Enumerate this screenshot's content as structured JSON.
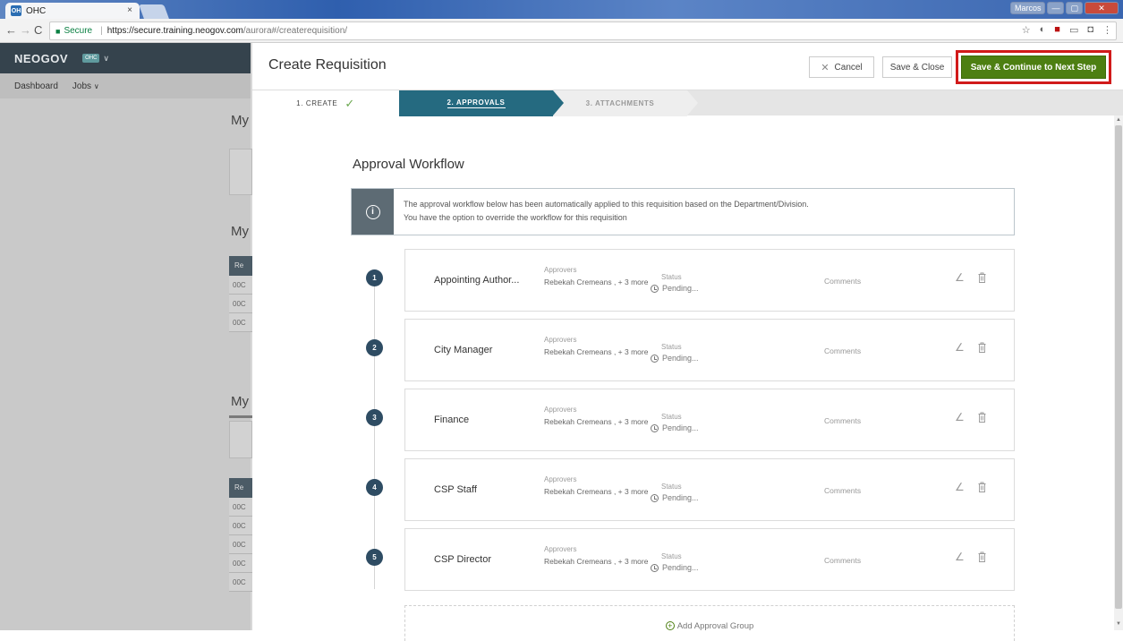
{
  "browser": {
    "tab_title": "OHC",
    "tab_favicon": "OH",
    "tab_close": "×",
    "window_user": "Marcos",
    "secure_label": "Secure",
    "url_host": "https://secure.training.neogov.com",
    "url_path": "/aurora#/createrequisition/"
  },
  "app": {
    "logo": "NEOGOV",
    "org_badge": "OHC",
    "nav": [
      "Dashboard",
      "Jobs"
    ],
    "bg_headings": [
      "My",
      "My",
      "My"
    ],
    "bg_header_label": "Re",
    "bg_row_label": "00C"
  },
  "modal": {
    "title": "Create Requisition",
    "cancel_label": "Cancel",
    "save_close_label": "Save & Close",
    "save_continue_label": "Save & Continue to Next Step",
    "steps": [
      {
        "label": "1. CREATE",
        "state": "complete"
      },
      {
        "label": "2. APPROVALS",
        "state": "active"
      },
      {
        "label": "3. ATTACHMENTS",
        "state": "upcoming"
      }
    ],
    "section_title": "Approval Workflow",
    "info_line1": "The approval workflow below has been automatically applied to this requisition based on the Department/Division.",
    "info_line2": "You have the option to override the workflow for this requisition",
    "labels": {
      "approvers": "Approvers",
      "status": "Status",
      "comments": "Comments"
    },
    "groups": [
      {
        "number": "1",
        "name": "Appointing Author...",
        "approvers": "Rebekah Cremeans , + 3 more",
        "status": "Pending..."
      },
      {
        "number": "2",
        "name": "City Manager",
        "approvers": "Rebekah Cremeans , + 3 more",
        "status": "Pending..."
      },
      {
        "number": "3",
        "name": "Finance",
        "approvers": "Rebekah Cremeans , + 3 more",
        "status": "Pending..."
      },
      {
        "number": "4",
        "name": "CSP Staff",
        "approvers": "Rebekah Cremeans , + 3 more",
        "status": "Pending..."
      },
      {
        "number": "5",
        "name": "CSP Director",
        "approvers": "Rebekah Cremeans , + 3 more",
        "status": "Pending..."
      }
    ],
    "add_group_label": "Add Approval Group"
  },
  "colors": {
    "primary_green": "#4d7f12",
    "active_step": "#256a80",
    "highlight_red": "#d11a1a",
    "step_badge": "#2e4c63"
  }
}
